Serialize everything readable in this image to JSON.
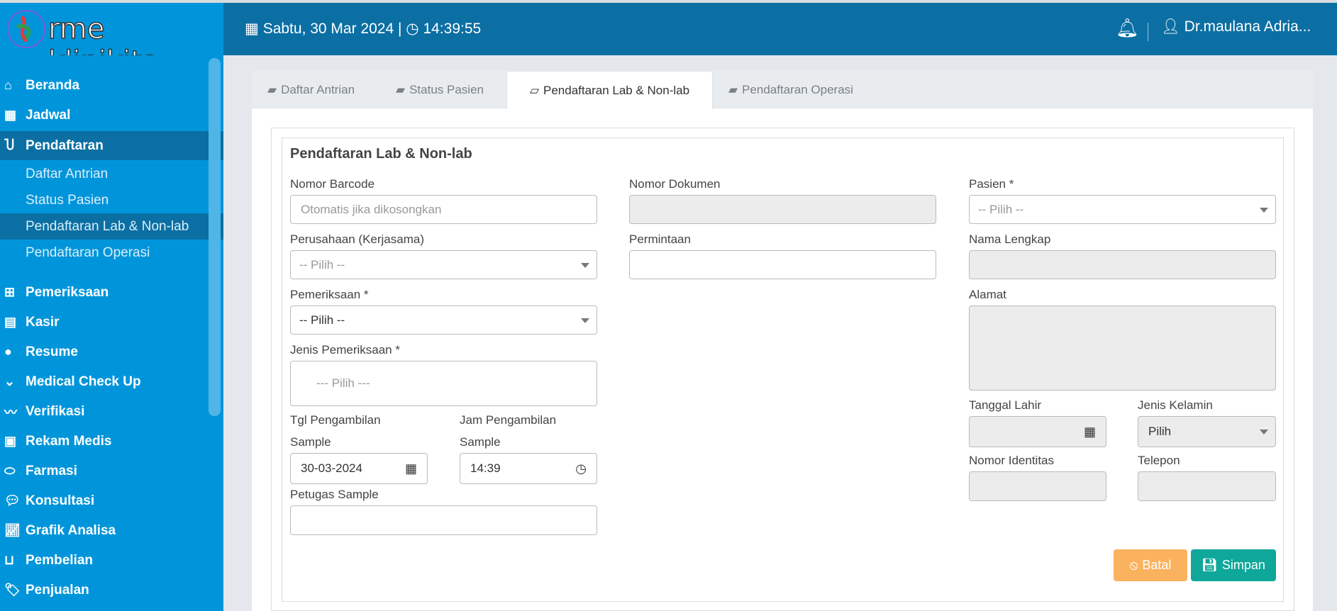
{
  "app": {
    "logo_text": "rme klinikita",
    "datetime": "Sabtu, 30 Mar 2024 | ",
    "time": "14:39:55",
    "user": "Dr.maulana Adria..."
  },
  "sidebar": {
    "items": [
      {
        "label": "Beranda",
        "icon": "home-icon"
      },
      {
        "label": "Jadwal",
        "icon": "calendar-icon"
      },
      {
        "label": "Pendaftaran",
        "icon": "stethoscope-icon",
        "active": true
      },
      {
        "label": "Pemeriksaan",
        "icon": "medkit-icon"
      },
      {
        "label": "Kasir",
        "icon": "cash-register-icon"
      },
      {
        "label": "Resume",
        "icon": "user-doctor-icon"
      },
      {
        "label": "Medical Check Up",
        "icon": "check-circle-icon"
      },
      {
        "label": "Verifikasi",
        "icon": "signature-icon"
      },
      {
        "label": "Rekam Medis",
        "icon": "medical-book-icon"
      },
      {
        "label": "Farmasi",
        "icon": "pills-icon"
      },
      {
        "label": "Konsultasi",
        "icon": "chat-icon"
      },
      {
        "label": "Grafik Analisa",
        "icon": "chart-line-icon"
      },
      {
        "label": "Pembelian",
        "icon": "basket-icon"
      },
      {
        "label": "Penjualan",
        "icon": "tags-icon"
      }
    ],
    "sub": [
      "Daftar Antrian",
      "Status Pasien",
      "Pendaftaran Lab & Non-lab",
      "Pendaftaran Operasi"
    ]
  },
  "tabs": [
    "Daftar Antrian",
    "Status Pasien",
    "Pendaftaran Lab & Non-lab",
    "Pendaftaran Operasi"
  ],
  "form": {
    "title": "Pendaftaran Lab & Non-lab",
    "nomor_barcode": {
      "label": "Nomor Barcode",
      "placeholder": "Otomatis jika dikosongkan"
    },
    "perusahaan": {
      "label": "Perusahaan (Kerjasama)",
      "value": "-- Pilih --"
    },
    "pemeriksaan": {
      "label": "Pemeriksaan *",
      "value": "-- Pilih --"
    },
    "jenis_pemeriksaan": {
      "label": "Jenis Pemeriksaan *",
      "placeholder": "--- Pilih ---"
    },
    "tgl": {
      "label1": "Tgl Pengambilan",
      "label2": "Sample",
      "value": "30-03-2024"
    },
    "jam": {
      "label1": "Jam Pengambilan",
      "label2": "Sample",
      "value": "14:39"
    },
    "petugas": {
      "label": "Petugas Sample",
      "value": ""
    },
    "nomor_dokumen": {
      "label": "Nomor Dokumen",
      "value": ""
    },
    "permintaan": {
      "label": "Permintaan",
      "value": ""
    },
    "pasien": {
      "label": "Pasien *",
      "value": "-- Pilih --"
    },
    "nama": {
      "label": "Nama Lengkap",
      "value": ""
    },
    "alamat": {
      "label": "Alamat",
      "value": ""
    },
    "tanggal_lahir": {
      "label": "Tanggal Lahir",
      "value": ""
    },
    "jenis_kelamin": {
      "label": "Jenis Kelamin",
      "value": "Pilih"
    },
    "nomor_identitas": {
      "label": "Nomor Identitas",
      "value": ""
    },
    "telepon": {
      "label": "Telepon",
      "value": ""
    },
    "batal": "Batal",
    "simpan": "Simpan"
  },
  "colors": {
    "sidebar": "#0095db",
    "header": "#0b6fa3",
    "batal": "#fbb25f",
    "simpan": "#0ea79a"
  }
}
